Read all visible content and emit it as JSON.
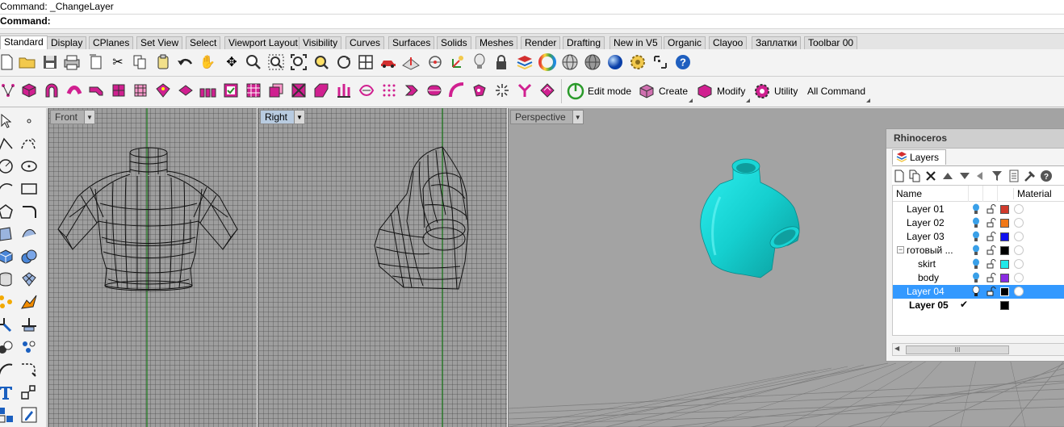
{
  "command": {
    "line1": "Command: _ChangeLayer",
    "line2": "Command:"
  },
  "tabs": [
    {
      "label": "Standard",
      "active": true
    },
    {
      "label": "Display"
    },
    {
      "label": "CPlanes"
    },
    {
      "label": "Set View"
    },
    {
      "label": "Select"
    },
    {
      "label": "Viewport Layout"
    },
    {
      "label": "Visibility"
    },
    {
      "label": "Curves"
    },
    {
      "label": "Surfaces"
    },
    {
      "label": "Solids"
    },
    {
      "label": "Meshes"
    },
    {
      "label": "Render"
    },
    {
      "label": "Drafting"
    },
    {
      "label": "New in V5"
    },
    {
      "label": "Organic"
    },
    {
      "label": "Clayoo"
    },
    {
      "label": "Заплатки"
    },
    {
      "label": "Toolbar 00"
    }
  ],
  "toolbar_named": {
    "edit_mode": "Edit mode",
    "create": "Create",
    "modify": "Modify",
    "utility": "Utility",
    "all_command": "All Command"
  },
  "viewports": {
    "front": "Front",
    "right": "Right",
    "perspective": "Perspective",
    "active": "Right"
  },
  "panel": {
    "title": "Rhinoceros",
    "tab": "Layers",
    "col_name": "Name",
    "col_material": "Material",
    "scroll_thumb": "III"
  },
  "layers": [
    {
      "name": "Layer 01",
      "color": "#d03a2c",
      "indent": 0
    },
    {
      "name": "Layer 02",
      "color": "#f07818",
      "indent": 0
    },
    {
      "name": "Layer 03",
      "color": "#1010f0",
      "indent": 0
    },
    {
      "name": "готовый ...",
      "color": "#000000",
      "indent": 0,
      "expander": "−"
    },
    {
      "name": "skirt",
      "color": "#20e8e8",
      "indent": 1
    },
    {
      "name": "body",
      "color": "#8a2be2",
      "indent": 1
    },
    {
      "name": "Layer 04",
      "color": "#000000",
      "indent": 0,
      "selected": true
    },
    {
      "name": "Layer 05",
      "color": "#000000",
      "indent": 0,
      "current": true,
      "check": "✔"
    }
  ],
  "colors": {
    "accent_selection": "#3399ff",
    "shirt": "#19d0d0",
    "viewport_gray": "#9e9e9e",
    "axis_green": "#1a7a1a"
  }
}
